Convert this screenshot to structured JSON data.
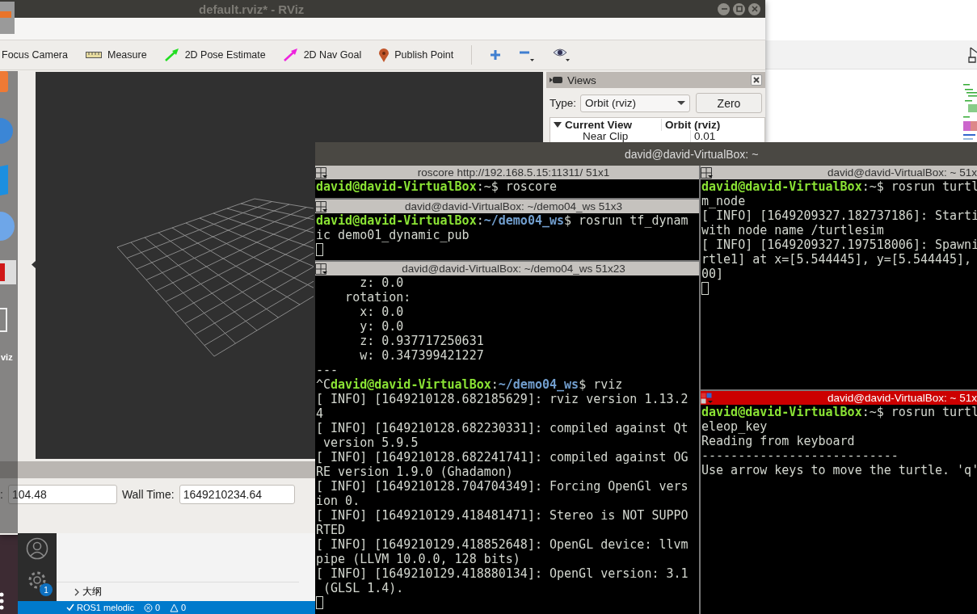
{
  "dock": {
    "label": "viz"
  },
  "rviz": {
    "title": "default.rviz* - RViz",
    "toolbar": [
      {
        "kind": "focus",
        "label": "Focus Camera"
      },
      {
        "kind": "measure",
        "label": "Measure"
      },
      {
        "kind": "arrow",
        "label": "2D Pose Estimate",
        "color": "#22dd22"
      },
      {
        "kind": "arrow",
        "label": "2D Nav Goal",
        "color": "#ee22dd"
      },
      {
        "kind": "point",
        "label": "Publish Point"
      },
      {
        "kind": "separator"
      },
      {
        "kind": "add"
      },
      {
        "kind": "remove"
      },
      {
        "kind": "eye"
      }
    ],
    "views": {
      "title": "Views",
      "type_label": "Type:",
      "type_value": "Orbit (rviz)",
      "button": "Zero",
      "tree": [
        {
          "name": "Current View",
          "value": "Orbit (rviz)",
          "expanded": true,
          "children": [
            {
              "name": "Near Clip",
              "value": "0.01"
            }
          ]
        }
      ]
    },
    "time": [
      {
        "label": ":",
        "value": "104.48"
      },
      {
        "label": "Wall Time:",
        "value": "1649210234.64"
      }
    ]
  },
  "terminal": {
    "title": "david@david-VirtualBox: ~",
    "columns": [
      [
        {
          "header": "roscore http://192.168.5.15:11311/ 51x1",
          "focused": false,
          "lines": [
            {
              "kind": "prompt",
              "segments": [
                {
                  "kind": "user",
                  "text": "david@david-VirtualBox"
                },
                {
                  "kind": "plain",
                  "text": ":~$ roscore"
                }
              ]
            }
          ]
        },
        {
          "header": "david@david-VirtualBox: ~/demo04_ws 51x3",
          "focused": false,
          "lines": [
            {
              "kind": "prompt",
              "segments": [
                {
                  "kind": "user",
                  "text": "david@david-VirtualBox"
                },
                {
                  "kind": "plain",
                  "text": ":"
                },
                {
                  "kind": "path",
                  "text": "~/demo04_ws"
                },
                {
                  "kind": "plain",
                  "text": "$ rosrun tf_dynam"
                }
              ]
            },
            {
              "kind": "text",
              "text": "ic demo01_dynamic_pub"
            },
            {
              "kind": "cursor"
            }
          ]
        },
        {
          "header": "david@david-VirtualBox: ~/demo04_ws 51x23",
          "focused": false,
          "lines": [
            {
              "kind": "text",
              "text": "      z: 0.0"
            },
            {
              "kind": "text",
              "text": "    rotation:"
            },
            {
              "kind": "text",
              "text": "      x: 0.0"
            },
            {
              "kind": "text",
              "text": "      y: 0.0"
            },
            {
              "kind": "text",
              "text": "      z: 0.937717250631"
            },
            {
              "kind": "text",
              "text": "      w: 0.347399421227"
            },
            {
              "kind": "text",
              "text": "---"
            },
            {
              "kind": "prompt",
              "segments": [
                {
                  "kind": "plain",
                  "text": "^C"
                },
                {
                  "kind": "user",
                  "text": "david@david-VirtualBox"
                },
                {
                  "kind": "plain",
                  "text": ":"
                },
                {
                  "kind": "path",
                  "text": "~/demo04_ws"
                },
                {
                  "kind": "plain",
                  "text": "$ rviz"
                }
              ]
            },
            {
              "kind": "text",
              "text": "[ INFO] [1649210128.682185629]: rviz version 1.13.2"
            },
            {
              "kind": "text",
              "text": "4"
            },
            {
              "kind": "text",
              "text": "[ INFO] [1649210128.682230331]: compiled against Qt"
            },
            {
              "kind": "text",
              "text": " version 5.9.5"
            },
            {
              "kind": "text",
              "text": "[ INFO] [1649210128.682241741]: compiled against OG"
            },
            {
              "kind": "text",
              "text": "RE version 1.9.0 (Ghadamon)"
            },
            {
              "kind": "text",
              "text": "[ INFO] [1649210128.704704349]: Forcing OpenGl vers"
            },
            {
              "kind": "text",
              "text": "ion 0."
            },
            {
              "kind": "text",
              "text": "[ INFO] [1649210129.418481471]: Stereo is NOT SUPPO"
            },
            {
              "kind": "text",
              "text": "RTED"
            },
            {
              "kind": "text",
              "text": "[ INFO] [1649210129.418852648]: OpenGL device: llvm"
            },
            {
              "kind": "text",
              "text": "pipe (LLVM 10.0.0, 128 bits)"
            },
            {
              "kind": "text",
              "text": "[ INFO] [1649210129.418880134]: OpenGl version: 3.1"
            },
            {
              "kind": "text",
              "text": " (GLSL 1.4)."
            },
            {
              "kind": "cursor"
            }
          ]
        }
      ],
      [
        {
          "header": "david@david-VirtualBox: ~ 51x",
          "focused": false,
          "lines": [
            {
              "kind": "prompt",
              "segments": [
                {
                  "kind": "user",
                  "text": "david@david-VirtualBox"
                },
                {
                  "kind": "plain",
                  "text": ":~$ rosrun turtl"
                }
              ]
            },
            {
              "kind": "text",
              "text": "m_node"
            },
            {
              "kind": "text",
              "text": "[ INFO] [1649209327.182737186]: Starti"
            },
            {
              "kind": "text",
              "text": "with node name /turtlesim"
            },
            {
              "kind": "text",
              "text": "[ INFO] [1649209327.197518006]: Spawni"
            },
            {
              "kind": "text",
              "text": "rtle1] at x=[5.544445], y=[5.544445],"
            },
            {
              "kind": "text",
              "text": "00]"
            },
            {
              "kind": "cursor"
            }
          ]
        },
        {
          "header": "david@david-VirtualBox: ~ 51x",
          "focused": true,
          "lines": [
            {
              "kind": "prompt",
              "segments": [
                {
                  "kind": "user",
                  "text": "david@david-VirtualBox"
                },
                {
                  "kind": "plain",
                  "text": ":~$ rosrun turtl"
                }
              ]
            },
            {
              "kind": "text",
              "text": "eleop_key"
            },
            {
              "kind": "text",
              "text": "Reading from keyboard"
            },
            {
              "kind": "text",
              "text": "---------------------------"
            },
            {
              "kind": "text",
              "text": "Use arrow keys to move the turtle. 'q'"
            }
          ]
        }
      ]
    ]
  },
  "editor": {
    "badge": "1",
    "outline": "大纲",
    "status": [
      {
        "kind": "remote",
        "label": "ROS1 melodic"
      },
      {
        "kind": "errors",
        "label": "0"
      },
      {
        "kind": "warnings",
        "label": "0"
      }
    ]
  }
}
